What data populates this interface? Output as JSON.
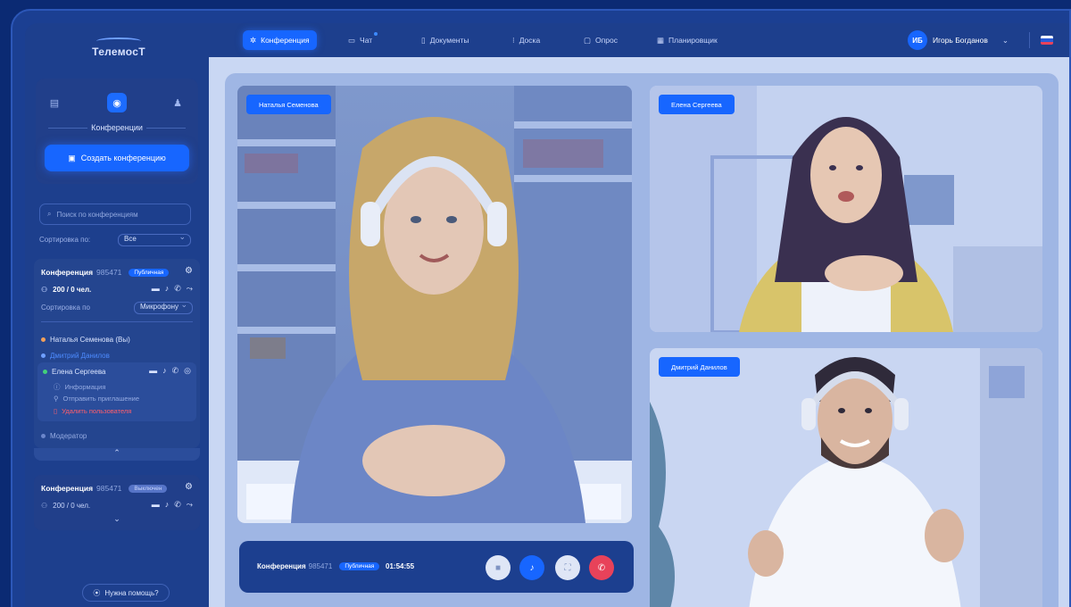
{
  "app": {
    "logo": "ТелемосТ"
  },
  "sidebar": {
    "section_title": "Конференции",
    "create_button": "Создать конференцию",
    "search_placeholder": "Поиск по конференциям",
    "sort_label": "Сортировка по:",
    "sort_value": "Все",
    "conference1": {
      "title": "Конференция",
      "number": "985471",
      "badge": "Публичная",
      "count": "200 / 0 чел.",
      "sort_label": "Сортировка по",
      "sort_value": "Микрофону",
      "participants": [
        {
          "name": "Наталья Семенова (Вы)"
        },
        {
          "name": "Дмитрий Данилов"
        },
        {
          "name": "Елена Сергеева"
        }
      ],
      "menu": [
        "Информация",
        "Отправить приглашение",
        "Удалить пользователя"
      ],
      "moderator": "Модератор"
    },
    "conference2": {
      "title": "Конференция",
      "number": "985471",
      "badge": "Выключен",
      "count": "200 / 0 чел."
    },
    "help": "Нужна помощь?"
  },
  "topbar": {
    "tabs": [
      "Конференция",
      "Чат",
      "Документы",
      "Доска",
      "Опрос",
      "Планировщик"
    ],
    "active_tab": "Конференция",
    "user_initials": "ИБ",
    "user_name": "Игорь Богданов"
  },
  "videos": [
    {
      "name": "Наталья Семенова"
    },
    {
      "name": "Елена Сергеева"
    },
    {
      "name": "Дмитрий Данилов"
    }
  ],
  "call_bar": {
    "title": "Конференция",
    "number": "985471",
    "badge": "Публичная",
    "time": "01:54:55"
  },
  "colors": {
    "accent": "#1766ff",
    "end_call": "#e8425a",
    "sidebar": "#1d3f8d"
  }
}
